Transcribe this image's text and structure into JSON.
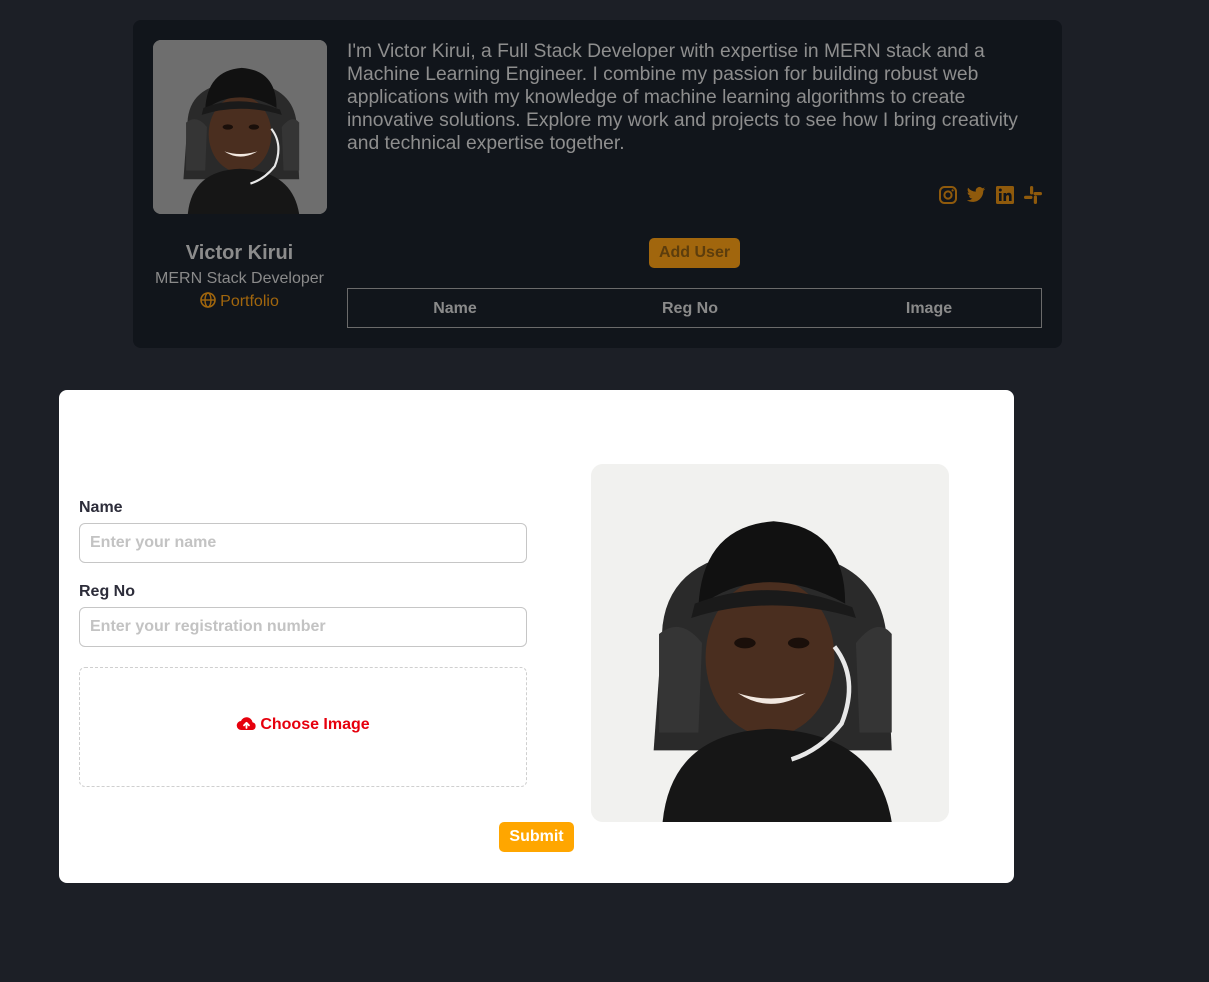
{
  "profile": {
    "name": "Victor Kirui",
    "role": "MERN Stack Developer",
    "portfolio_label": "Portfolio",
    "bio": "I'm Victor Kirui, a Full Stack Developer with expertise in MERN stack and a Machine Learning Engineer. I combine my passion for building robust web applications with my knowledge of machine learning algorithms to create innovative solutions. Explore my work and projects to see how I bring creativity and technical expertise together.",
    "socials": [
      "instagram-icon",
      "twitter-icon",
      "linkedin-icon",
      "slack-icon"
    ],
    "accent_color": "#a1660d"
  },
  "toolbar": {
    "add_user_label": "Add User"
  },
  "users_table": {
    "columns": [
      "Name",
      "Reg No",
      "Image"
    ],
    "rows": []
  },
  "form": {
    "name_label": "Name",
    "name_placeholder": "Enter your name",
    "reg_label": "Reg No",
    "reg_placeholder": "Enter your registration number",
    "upload_label": "Choose Image",
    "upload_icon": "cloud-upload-icon",
    "submit_label": "Submit",
    "submit_color": "#ffa600"
  }
}
